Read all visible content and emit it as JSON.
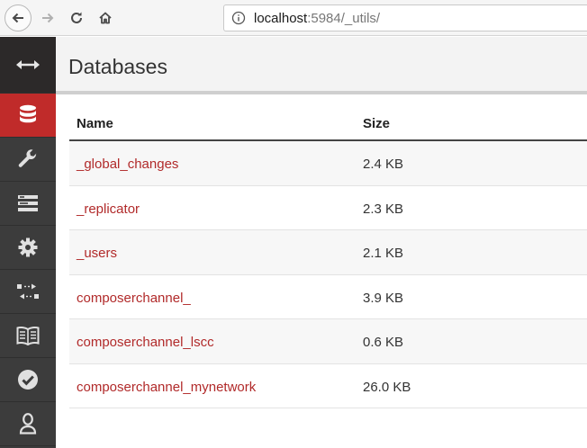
{
  "browser": {
    "url_host": "localhost",
    "url_rest": ":5984/_utils/",
    "icons": [
      "back-arrow-icon",
      "forward-arrow-icon",
      "reload-icon",
      "home-icon",
      "info-icon"
    ]
  },
  "sidebar": {
    "items": [
      {
        "name": "toggle-menu",
        "icon": "double-arrow-icon",
        "active": false
      },
      {
        "name": "databases",
        "icon": "database-icon",
        "active": true
      },
      {
        "name": "setup",
        "icon": "wrench-icon",
        "active": false
      },
      {
        "name": "active-tasks",
        "icon": "tasks-icon",
        "active": false
      },
      {
        "name": "configuration",
        "icon": "gear-icon",
        "active": false
      },
      {
        "name": "replication",
        "icon": "replication-icon",
        "active": false
      },
      {
        "name": "documentation",
        "icon": "book-icon",
        "active": false
      },
      {
        "name": "verify",
        "icon": "check-circle-icon",
        "active": false
      },
      {
        "name": "user",
        "icon": "user-icon",
        "active": false
      }
    ],
    "colors": {
      "background": "#3c3c3c",
      "active": "#c02b2a"
    }
  },
  "main": {
    "title": "Databases",
    "table": {
      "headers": {
        "name": "Name",
        "size": "Size"
      },
      "rows": [
        {
          "name": "_global_changes",
          "size": "2.4 KB"
        },
        {
          "name": "_replicator",
          "size": "2.3 KB"
        },
        {
          "name": "_users",
          "size": "2.1 KB"
        },
        {
          "name": "composerchannel_",
          "size": "3.9 KB"
        },
        {
          "name": "composerchannel_lscc",
          "size": "0.6 KB"
        },
        {
          "name": "composerchannel_mynetwork",
          "size": "26.0 KB"
        }
      ]
    },
    "colors": {
      "link": "#b12a2a"
    }
  }
}
